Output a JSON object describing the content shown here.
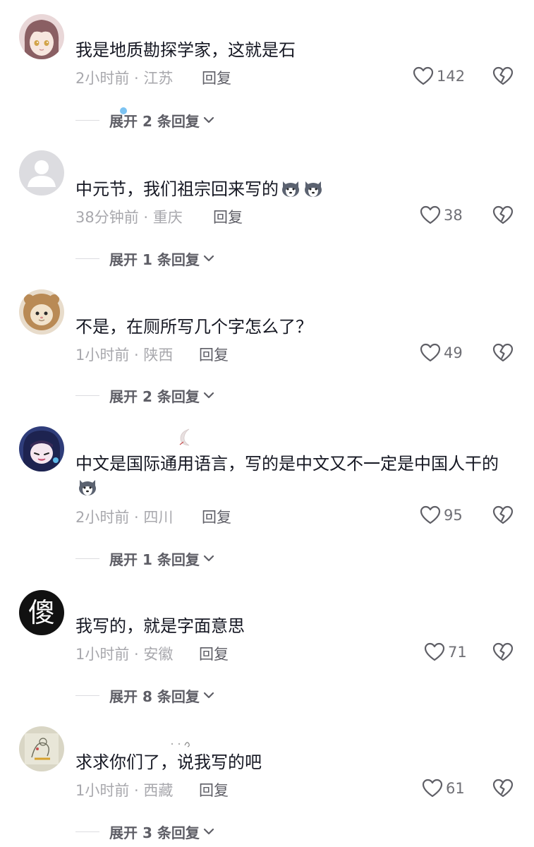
{
  "colors": {
    "text": "#161823",
    "meta": "#a8a8ad",
    "reply": "#5e5e66",
    "background": "#ffffff"
  },
  "comments": [
    {
      "avatar_icon": "anime-girl-avatar",
      "username": "",
      "text": "我是地质勘探学家，这就是石",
      "time": "2小时前",
      "location": "江苏",
      "meta": "2小时前 · 江苏",
      "reply_label": "回复",
      "likes": "142",
      "expand_label": "展开 2 条回复"
    },
    {
      "avatar_icon": "default-user-avatar",
      "username": "",
      "text": "中元节，我们祖宗回来写的",
      "emojis": [
        "husky-emoji",
        "husky-emoji"
      ],
      "time": "38分钟前",
      "location": "重庆",
      "meta": "38分钟前 · 重庆",
      "reply_label": "回复",
      "likes": "38",
      "expand_label": "展开 1 条回复"
    },
    {
      "avatar_icon": "lion-cat-avatar",
      "username": "",
      "text": "不是，在厕所写几个字怎么了？",
      "time": "1小时前",
      "location": "陕西",
      "meta": "1小时前 · 陕西",
      "reply_label": "回复",
      "likes": "49",
      "expand_label": "展开 2 条回复"
    },
    {
      "avatar_icon": "anime-character-avatar",
      "username": "",
      "text": "中文是国际通用语言，写的是中文又不一定是中国人干的",
      "emojis": [
        "husky-emoji"
      ],
      "time": "2小时前",
      "location": "四川",
      "meta": "2小时前 · 四川",
      "reply_label": "回复",
      "likes": "95",
      "expand_label": "展开 1 条回复"
    },
    {
      "avatar_icon": "sha-character-avatar",
      "avatar_text": "傻",
      "username": "",
      "text": "我写的，就是字面意思",
      "time": "1小时前",
      "location": "安徽",
      "meta": "1小时前 · 安徽",
      "reply_label": "回复",
      "likes": "71",
      "expand_label": "展开 8 条回复"
    },
    {
      "avatar_icon": "sketch-art-avatar",
      "username": "",
      "text": "求求你们了，说我写的吧",
      "time": "1小时前",
      "location": "西藏",
      "meta": "1小时前 · 西藏",
      "reply_label": "回复",
      "likes": "61",
      "expand_label": "展开 3 条回复"
    }
  ]
}
